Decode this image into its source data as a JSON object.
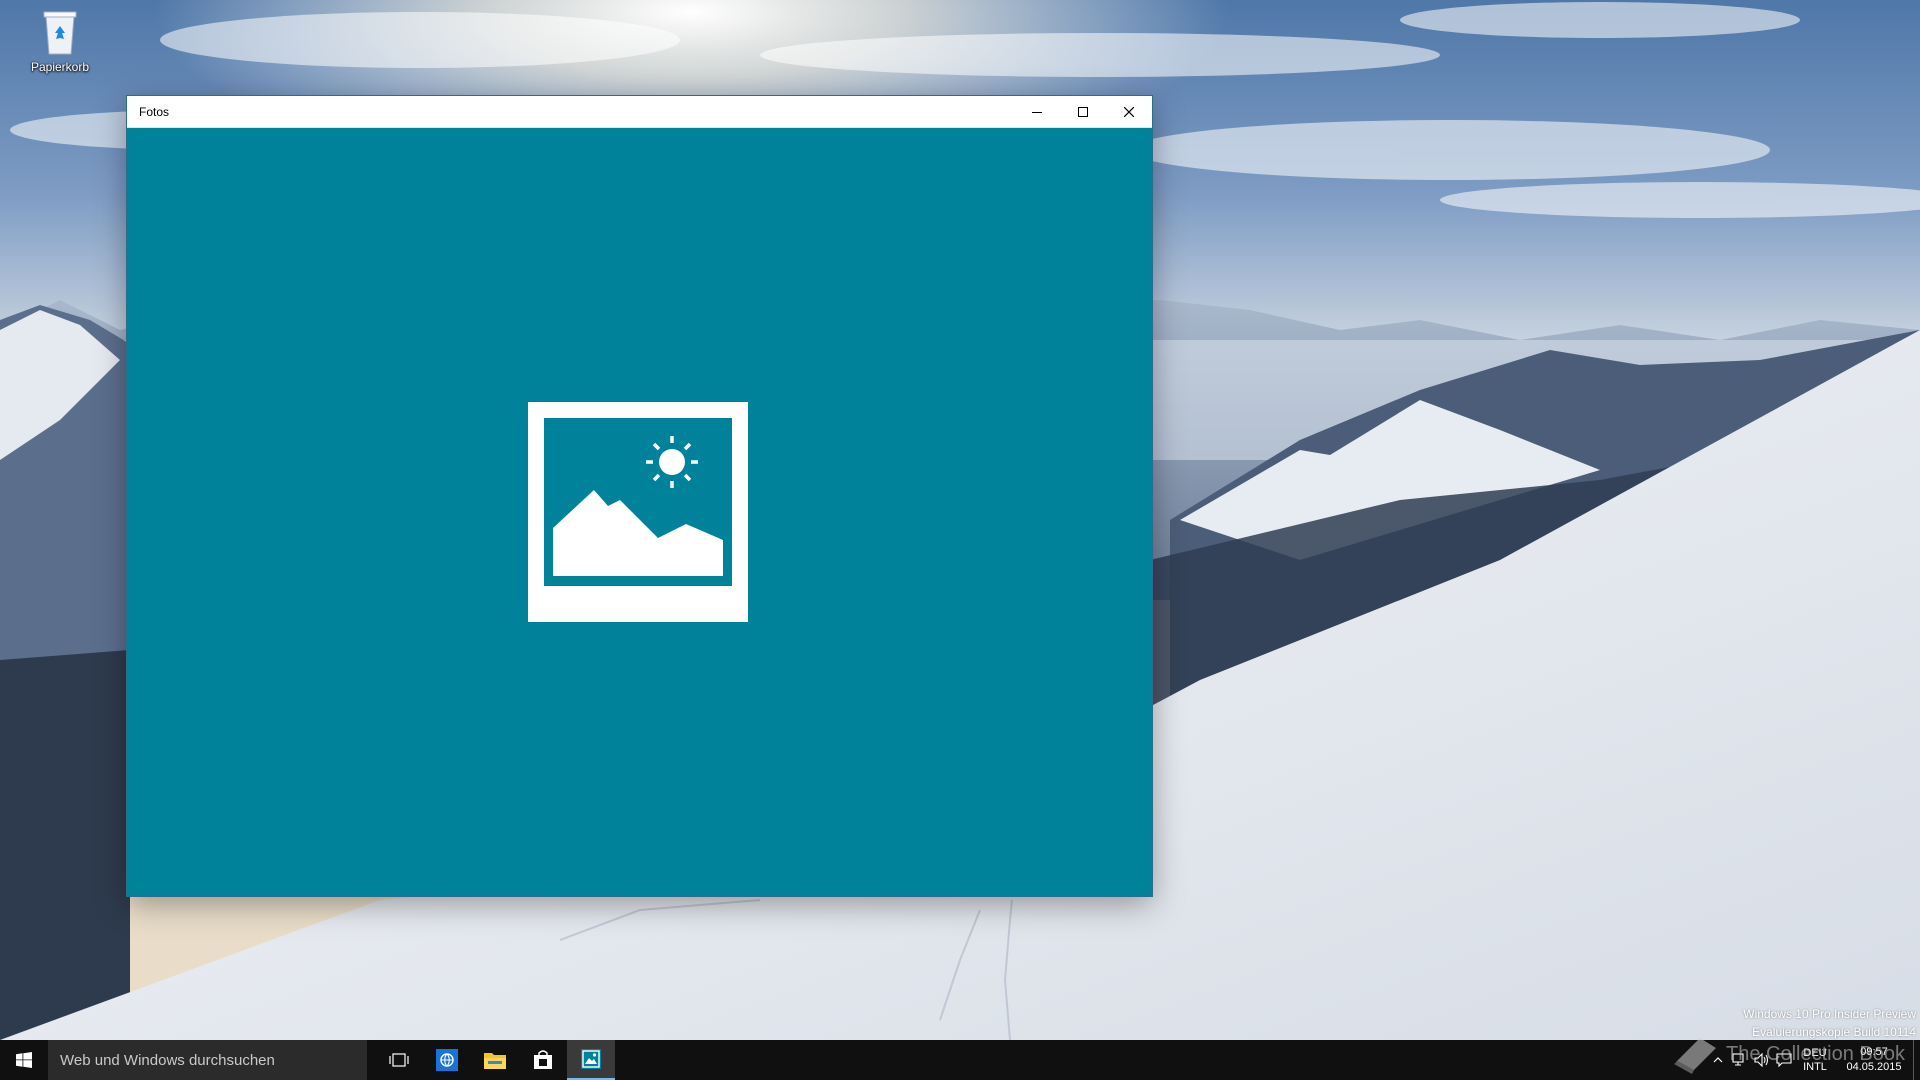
{
  "desktop": {
    "recycle_bin_label": "Papierkorb"
  },
  "window": {
    "title": "Fotos",
    "minimize_icon": "minimize-icon",
    "maximize_icon": "maximize-icon",
    "close_icon": "close-icon",
    "body_color": "#00829b",
    "splash_icon": "photos-app-icon"
  },
  "watermark": {
    "line1": "Windows 10 Pro Insider Preview",
    "line2": "Evaluierungskopie Build 10114",
    "brand": "The Collection Book"
  },
  "taskbar": {
    "search_placeholder": "Web und Windows durchsuchen",
    "pinned": [
      {
        "name": "task-view",
        "icon": "task-view-icon"
      },
      {
        "name": "edge",
        "icon": "browser-icon"
      },
      {
        "name": "file-explorer",
        "icon": "folder-icon"
      },
      {
        "name": "store",
        "icon": "store-icon"
      },
      {
        "name": "photos",
        "icon": "photos-icon",
        "active": true
      }
    ],
    "tray": {
      "lang_top": "DEU",
      "lang_bottom": "INTL",
      "time": "09:57",
      "date": "04.05.2015"
    }
  },
  "colors": {
    "accent": "#00829b",
    "taskbar": "#101010",
    "active_indicator": "#76b9ed"
  }
}
